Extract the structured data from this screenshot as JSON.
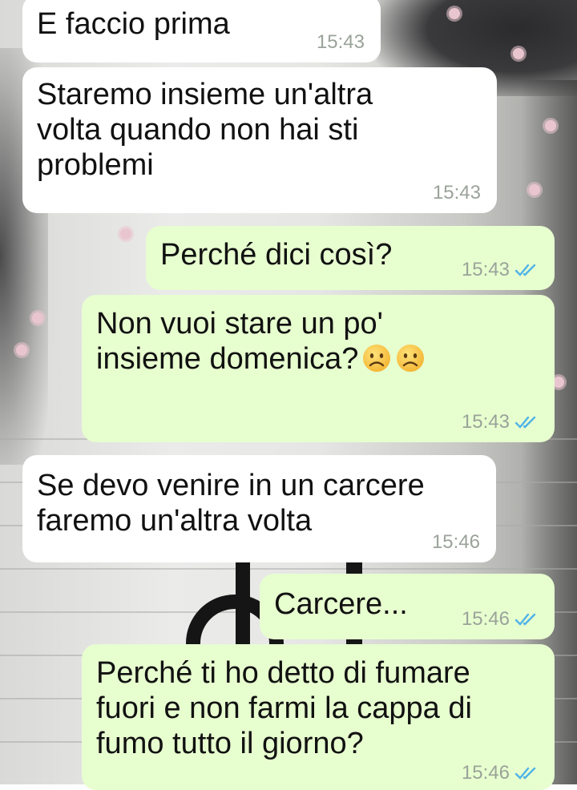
{
  "messages": [
    {
      "id": "m1",
      "direction": "incoming",
      "text": "E faccio prima",
      "time": "15:43"
    },
    {
      "id": "m2",
      "direction": "incoming",
      "text": "Staremo insieme un'altra\nvolta quando non hai sti\nproblemi",
      "time": "15:43"
    },
    {
      "id": "m3",
      "direction": "outgoing",
      "text": "Perché dici così?",
      "time": "15:43",
      "status_icon": "double-check-read-icon"
    },
    {
      "id": "m4",
      "direction": "outgoing",
      "text": "Non vuoi stare un po'\ninsieme domenica?",
      "emoji": [
        "frowning-face-emoji",
        "frowning-face-emoji"
      ],
      "time": "15:43",
      "status_icon": "double-check-read-icon"
    },
    {
      "id": "m5",
      "direction": "incoming",
      "text": "Se devo venire in un carcere\nfaremo un'altra volta",
      "time": "15:46"
    },
    {
      "id": "m6",
      "direction": "outgoing",
      "text": "Carcere...",
      "time": "15:46",
      "status_icon": "double-check-read-icon"
    },
    {
      "id": "m7",
      "direction": "outgoing",
      "text": "Perché ti ho detto di fumare\nfuori e non farmi la cappa di\nfumo tutto il giorno?",
      "time": "15:46",
      "status_icon": "double-check-read-icon"
    }
  ],
  "colors": {
    "incoming_bubble": "#ffffff",
    "outgoing_bubble": "#e7fecf",
    "timestamp": "#9aa39a",
    "read_check": "#4fb3e8"
  }
}
